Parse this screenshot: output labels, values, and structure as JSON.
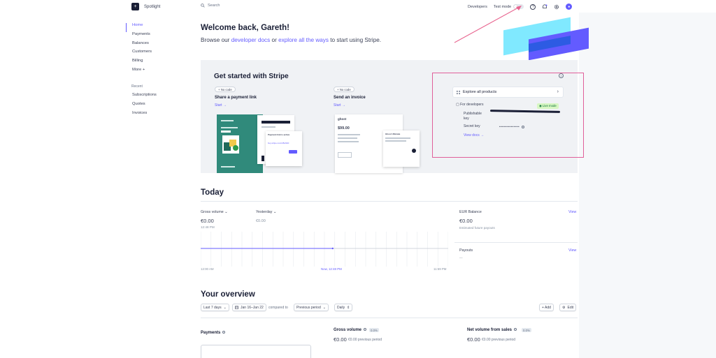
{
  "brand": {
    "name": "Spotlight"
  },
  "sidebar": {
    "items": [
      {
        "label": "Home"
      },
      {
        "label": "Payments"
      },
      {
        "label": "Balances"
      },
      {
        "label": "Customers"
      },
      {
        "label": "Billing"
      },
      {
        "label": "More +"
      }
    ],
    "recent_heading": "Recent",
    "recent": [
      {
        "label": "Subscriptions"
      },
      {
        "label": "Quotes"
      },
      {
        "label": "Invoices"
      }
    ]
  },
  "topbar": {
    "search_placeholder": "Search",
    "developers": "Developers",
    "test_mode": "Test mode"
  },
  "welcome": {
    "title": "Welcome back, Gareth!",
    "browse_prefix": "Browse our",
    "dev_docs": "developer docs",
    "or": "or",
    "explore_ways": "explore all the ways",
    "browse_suffix": "to start using Stripe."
  },
  "get_started": {
    "title": "Get started with Stripe",
    "options": [
      {
        "badge": "No code",
        "title": "Share a payment link",
        "start": "Start →"
      },
      {
        "badge": "No code",
        "title": "Send an invoice",
        "start": "Start →"
      }
    ],
    "illustration": {
      "payment_link_title": "Payment link is active",
      "payment_link_url": "buy.stripe.com/28o6Zd",
      "invoice_amount": "$99.00",
      "invoice_brand": "ghost",
      "invoice_popup": "Ghost Ultimate"
    },
    "explore_products": "Explore all products",
    "for_developers": "For developers",
    "live_mode": "Live mode",
    "publishable_key": "Publishable key",
    "secret_key": "Secret key",
    "secret_mask": "••••••••••••••",
    "view_docs": "View docs →"
  },
  "today": {
    "title": "Today",
    "gross_volume_label": "Gross volume",
    "gross_volume_value": "€0.00",
    "gross_volume_time": "12:48 PM",
    "yesterday_label": "Yesterday",
    "yesterday_value": "€0.00",
    "eur_balance_label": "EUR Balance",
    "eur_balance_value": "€0.00",
    "eur_balance_sub": "Estimated future payouts",
    "view": "View",
    "payouts_label": "Payouts",
    "payouts_value": "—",
    "axis": {
      "start": "12:00 AM",
      "now": "Now, 12:48 PM",
      "end": "11:59 PM"
    }
  },
  "overview": {
    "title": "Your overview",
    "range": "Last 7 days",
    "dates": "Jan 16–Jan 22",
    "compared_to": "compared to",
    "previous_period": "Previous period",
    "interval": "Daily",
    "add": "+ Add",
    "edit": "Edit",
    "payments": "Payments",
    "gross_volume": "Gross volume",
    "gross_pct": "0.0%",
    "gross_val": "€0.00",
    "gross_prev": "€0.00 previous period",
    "net_volume": "Net volume from sales",
    "net_pct": "0.0%",
    "net_val": "€0.00",
    "net_prev": "€0.00 previous period"
  },
  "colors": {
    "accent": "#635bff",
    "highlight_border": "#e0609a",
    "green_illus": "#308a7b"
  },
  "chart_data": {
    "type": "line",
    "series": [
      {
        "values": [
          0,
          0
        ]
      }
    ],
    "xlabels": [
      "12:00 AM",
      "Now, 12:48 PM",
      "11:59 PM"
    ]
  }
}
